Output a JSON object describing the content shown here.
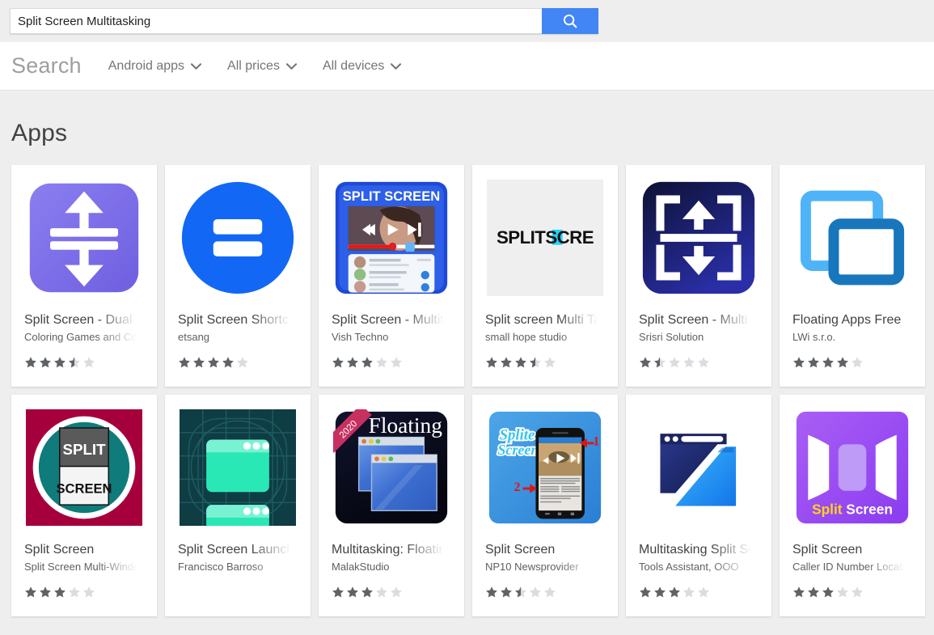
{
  "search": {
    "query": "Split Screen Multitasking",
    "placeholder": "Search",
    "button_icon": "search-icon"
  },
  "filters": {
    "title": "Search",
    "chips": [
      {
        "label": "Android apps",
        "icon": "chevron-down-icon"
      },
      {
        "label": "All prices",
        "icon": "chevron-down-icon"
      },
      {
        "label": "All devices",
        "icon": "chevron-down-icon"
      }
    ]
  },
  "section": {
    "title": "Apps"
  },
  "colors": {
    "accent": "#4285f4",
    "page_bg": "#eeeeee",
    "card_bg": "#ffffff",
    "star_on": "#5f6368",
    "star_off": "#dadce0",
    "title_text": "#424242",
    "dev_text": "#5f5f5f"
  },
  "apps": [
    {
      "title": "Split Screen - Dual Screen Apps",
      "developer": "Coloring Games and Coloring Book",
      "rating": 3.5,
      "icon": "split-screen-dual-arrows-icon",
      "truncated": true
    },
    {
      "title": "Split Screen Shortcut",
      "developer": "etsang",
      "rating": 4.0,
      "icon": "split-screen-shortcut-circle-icon",
      "truncated": true
    },
    {
      "title": "Split Screen - Multitasking",
      "developer": "Vish Techno",
      "rating": 3.0,
      "icon": "split-screen-video-chat-icon",
      "truncated": true
    },
    {
      "title": "Split screen Multi Tasking",
      "developer": "small hope studio",
      "rating": 3.5,
      "icon": "splitscreen-wordmark-icon",
      "truncated": true
    },
    {
      "title": "Split Screen - Multi Window",
      "developer": "Srisri Solution",
      "rating": 1.5,
      "icon": "split-screen-bracket-arrows-icon",
      "truncated": true
    },
    {
      "title": "Floating Apps Free",
      "developer": "LWi s.r.o.",
      "rating": 4.0,
      "icon": "floating-windows-blue-icon",
      "truncated": false
    },
    {
      "title": "Split Screen",
      "developer": "Split Screen Multi-Window",
      "rating": 3.0,
      "icon": "split-screen-teal-circle-icon",
      "truncated": true
    },
    {
      "title": "Split Screen Launcher",
      "developer": "Francisco Barroso",
      "rating": null,
      "icon": "split-screen-launcher-teal-icon",
      "truncated": true
    },
    {
      "title": "Multitasking: Floating Apps",
      "developer": "MalakStudio",
      "rating": 3.0,
      "icon": "multitasking-floating-2020-icon",
      "truncated": true
    },
    {
      "title": "Split Screen",
      "developer": "NP10 Newsprovider",
      "rating": 2.5,
      "icon": "splite-screen-phone-icon",
      "truncated": true
    },
    {
      "title": "Multitasking Split Screen",
      "developer": "Tools Assistant, OOO",
      "rating": 3.0,
      "icon": "multitasking-diagonal-windows-icon",
      "truncated": true
    },
    {
      "title": "Split Screen",
      "developer": "Caller ID Number Location",
      "rating": 3.0,
      "icon": "split-screen-purple-panels-icon",
      "truncated": true
    }
  ]
}
